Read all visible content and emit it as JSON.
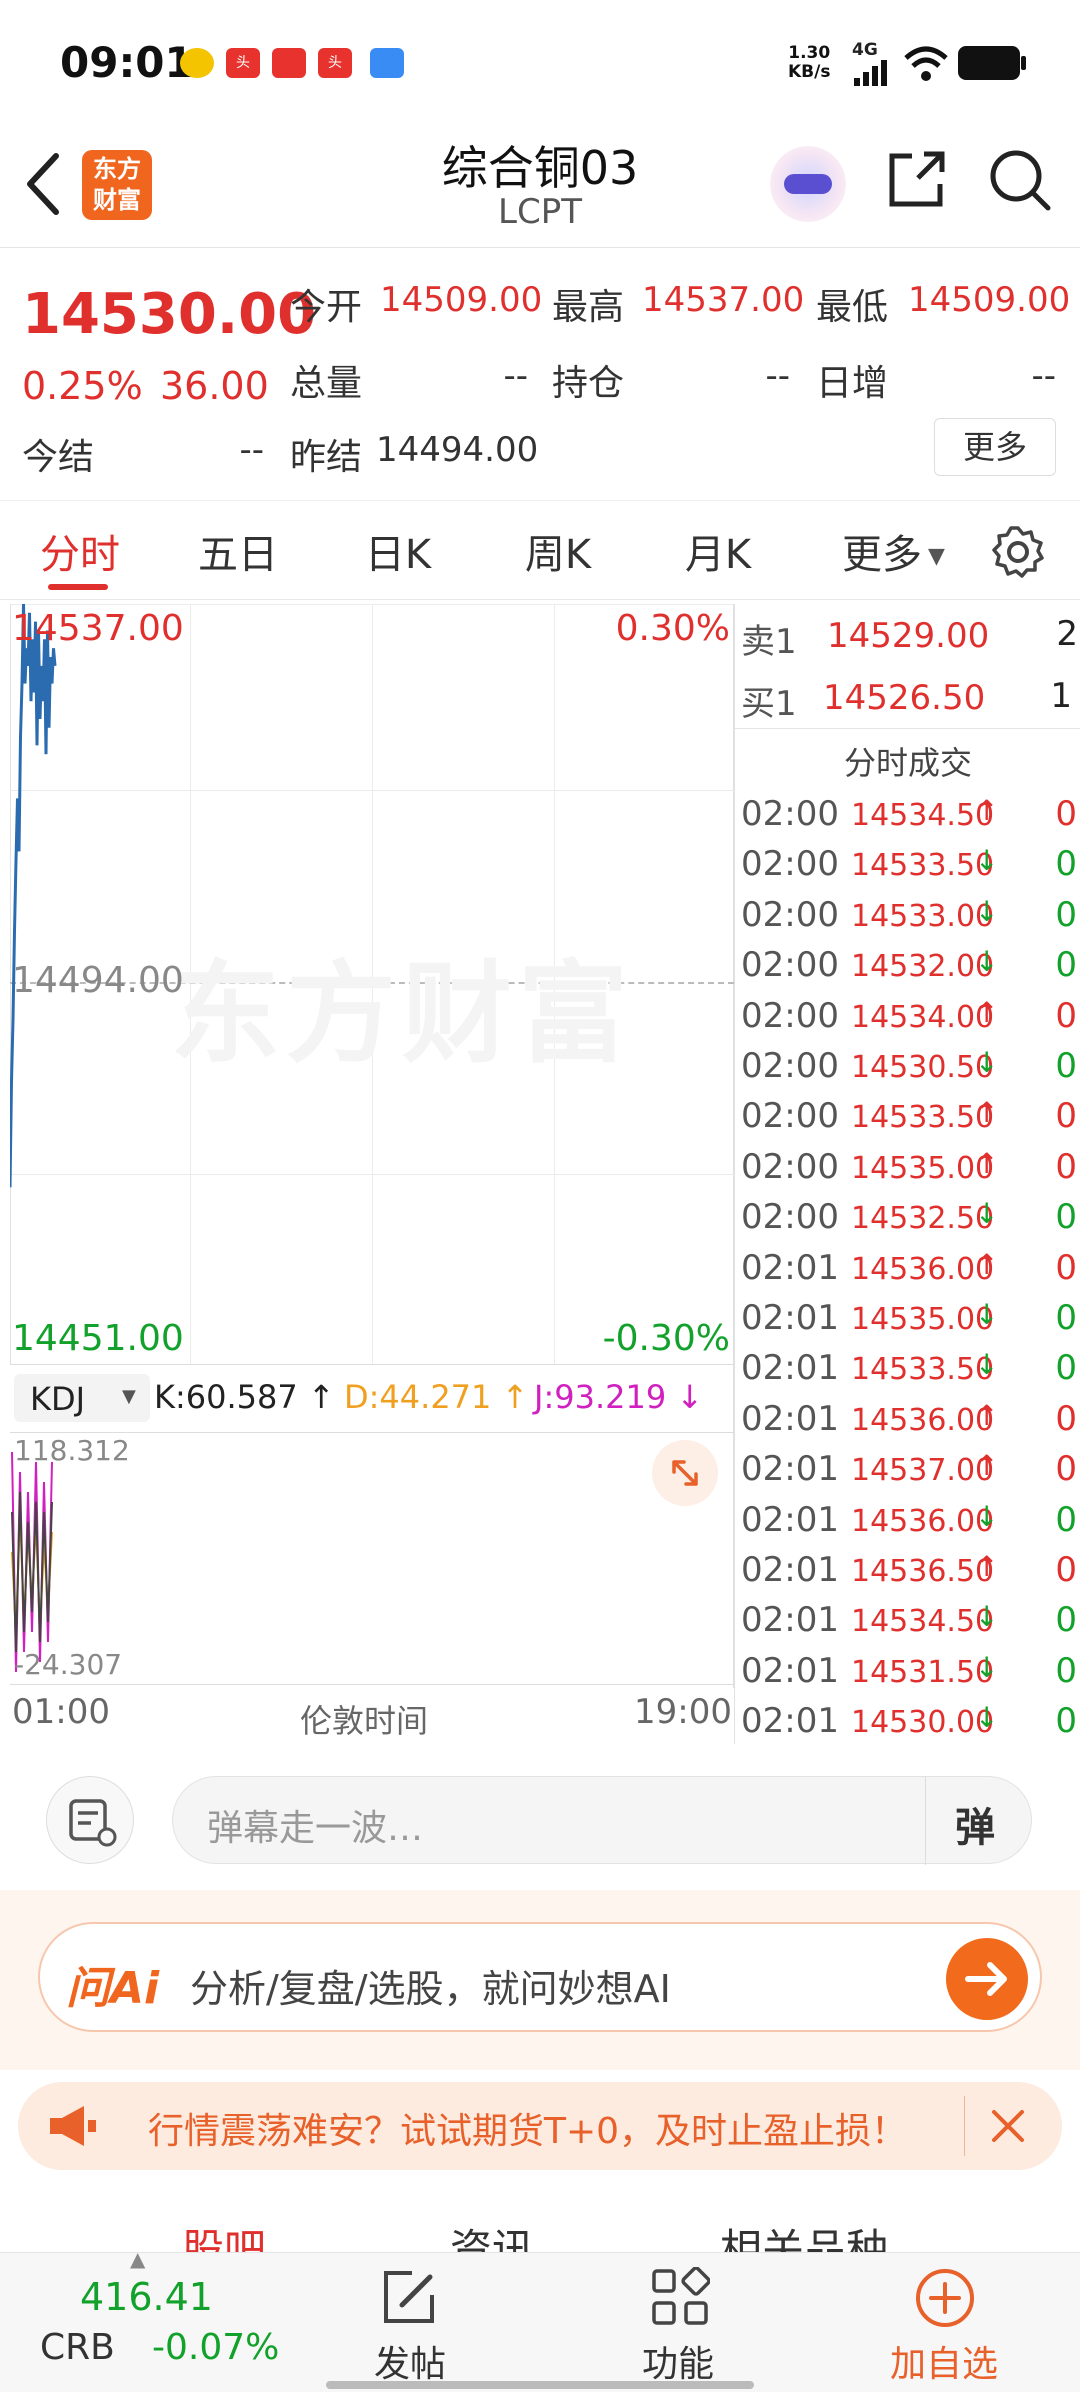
{
  "status_bar": {
    "time": "09:01",
    "net_speed": "1.30",
    "net_unit": "KB/s",
    "network": "4G",
    "apps": [
      "weibo-icon",
      "toutiao-icon",
      "news-app-icon",
      "toutiao-lite-icon",
      "blue-app-icon"
    ]
  },
  "header": {
    "logo_line1": "东方",
    "logo_line2": "财富",
    "title": "综合铜03",
    "subtitle": "LCPT"
  },
  "quote": {
    "price": "14530.00",
    "change_pct": "0.25%",
    "change": "36.00",
    "open_label": "今开",
    "open": "14509.00",
    "high_label": "最高",
    "high": "14537.00",
    "low_label": "最低",
    "low": "14509.00",
    "volume_label": "总量",
    "volume": "--",
    "position_label": "持仓",
    "position": "--",
    "daily_inc_label": "日增",
    "daily_inc": "--",
    "settle_label": "今结",
    "settle": "--",
    "prev_settle_label": "昨结",
    "prev_settle": "14494.00",
    "more_label": "更多"
  },
  "tabs": [
    "分时",
    "五日",
    "日K",
    "周K",
    "月K",
    "更多"
  ],
  "active_tab": "分时",
  "chart": {
    "top_price": "14537.00",
    "top_pct": "0.30%",
    "mid_price": "14494.00",
    "bottom_price": "14451.00",
    "bottom_pct": "-0.30%",
    "watermark": "东方财富",
    "kdj_label": "KDJ",
    "k_text": "K:60.587 ↑",
    "d_text": "D:44.271 ↑",
    "j_text": "J:93.219 ↓",
    "kdj_top": "118.312",
    "kdj_bottom": "-24.307",
    "x_start": "01:00",
    "x_mid": "伦敦时间",
    "x_end": "19:00",
    "colors": {
      "price_line": "#2b6cb0",
      "k": "#333333",
      "d": "#f0a020",
      "j": "#d020c0"
    }
  },
  "chart_data": {
    "type": "line",
    "title": "",
    "xlabel": "伦敦时间",
    "ylabel": "",
    "x_range": [
      "01:00",
      "19:00"
    ],
    "ylim": [
      14451.0,
      14537.0
    ],
    "reference": 14494.0,
    "series": [
      {
        "values": [
          14471,
          14483,
          14490,
          14500,
          14508,
          14515,
          14509,
          14522,
          14528,
          14537,
          14528,
          14532,
          14530,
          14536,
          14526,
          14533,
          14527,
          14535,
          14521,
          14534,
          14524,
          14530,
          14526,
          14533,
          14520,
          14534,
          14523,
          14531,
          14528,
          14532,
          14530
        ]
      }
    ]
  },
  "order_book": {
    "ask_label": "卖1",
    "ask_price": "14529.00",
    "ask_vol": "2",
    "bid_label": "买1",
    "bid_price": "14526.50",
    "bid_vol": "1",
    "ticks_title": "分时成交",
    "ticks": [
      {
        "time": "02:00",
        "price": "14534.50",
        "dir": "↑",
        "vol": "0"
      },
      {
        "time": "02:00",
        "price": "14533.50",
        "dir": "↓",
        "vol": "0"
      },
      {
        "time": "02:00",
        "price": "14533.00",
        "dir": "↓",
        "vol": "0"
      },
      {
        "time": "02:00",
        "price": "14532.00",
        "dir": "↓",
        "vol": "0"
      },
      {
        "time": "02:00",
        "price": "14534.00",
        "dir": "↑",
        "vol": "0"
      },
      {
        "time": "02:00",
        "price": "14530.50",
        "dir": "↓",
        "vol": "0"
      },
      {
        "time": "02:00",
        "price": "14533.50",
        "dir": "↑",
        "vol": "0"
      },
      {
        "time": "02:00",
        "price": "14535.00",
        "dir": "↑",
        "vol": "0"
      },
      {
        "time": "02:00",
        "price": "14532.50",
        "dir": "↓",
        "vol": "0"
      },
      {
        "time": "02:01",
        "price": "14536.00",
        "dir": "↑",
        "vol": "0"
      },
      {
        "time": "02:01",
        "price": "14535.00",
        "dir": "↓",
        "vol": "0"
      },
      {
        "time": "02:01",
        "price": "14533.50",
        "dir": "↓",
        "vol": "0"
      },
      {
        "time": "02:01",
        "price": "14536.00",
        "dir": "↑",
        "vol": "0"
      },
      {
        "time": "02:01",
        "price": "14537.00",
        "dir": "↑",
        "vol": "0"
      },
      {
        "time": "02:01",
        "price": "14536.00",
        "dir": "↓",
        "vol": "0"
      },
      {
        "time": "02:01",
        "price": "14536.50",
        "dir": "↑",
        "vol": "0"
      },
      {
        "time": "02:01",
        "price": "14534.50",
        "dir": "↓",
        "vol": "0"
      },
      {
        "time": "02:01",
        "price": "14531.50",
        "dir": "↓",
        "vol": "0"
      },
      {
        "time": "02:01",
        "price": "14530.00",
        "dir": "↓",
        "vol": "0"
      }
    ]
  },
  "comment": {
    "placeholder": "弹幕走一波…",
    "danmu_label": "弹"
  },
  "ai": {
    "brand": "问Ai",
    "prompt": "分析/复盘/选股，就问妙想AI"
  },
  "promo": {
    "text": "行情震荡难安？试试期货T+0，及时止盈止损！"
  },
  "section_tabs": [
    "股吧",
    "资讯",
    "相关品种"
  ],
  "bottom": {
    "crb_value": "416.41",
    "crb_label": "CRB",
    "crb_change": "-0.07%",
    "post_label": "发帖",
    "func_label": "功能",
    "add_label": "加自选"
  }
}
